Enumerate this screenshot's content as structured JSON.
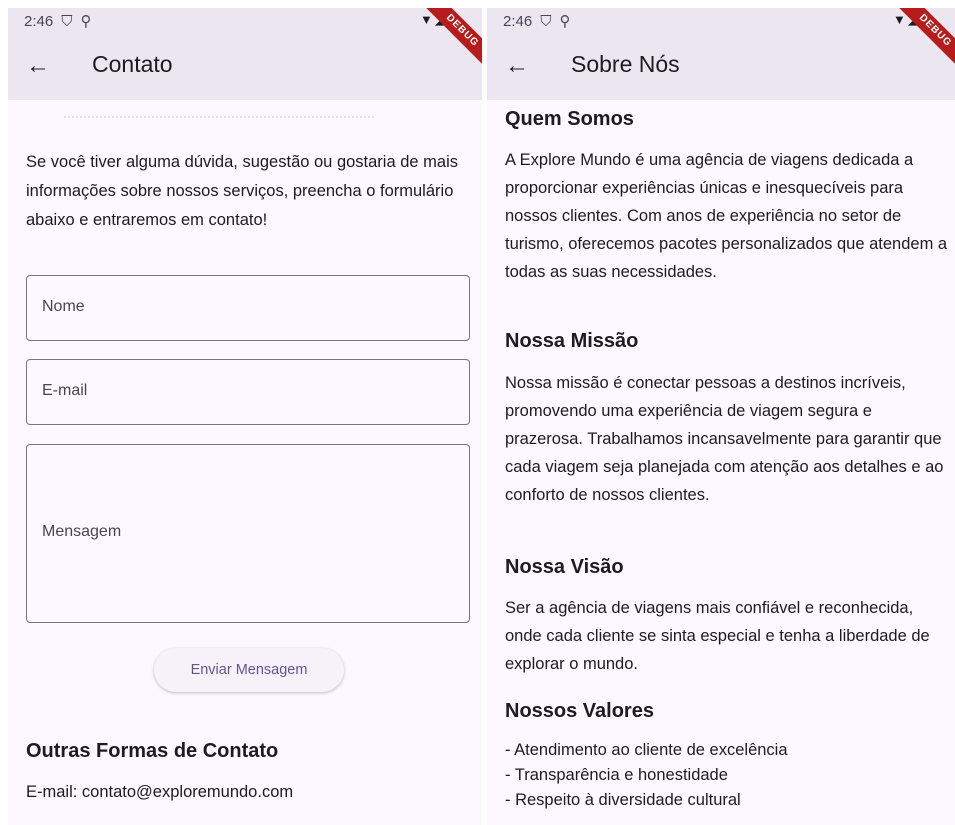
{
  "contact": {
    "status_time": "2:46",
    "title": "Contato",
    "intro": "Se você tiver alguma dúvida, sugestão ou gostaria de mais informações sobre nossos serviços, preencha o formulário abaixo e entraremos em contato!",
    "fields": {
      "name": "Nome",
      "email": "E-mail",
      "message": "Mensagem"
    },
    "send_label": "Enviar Mensagem",
    "other_heading": "Outras Formas de Contato",
    "email_line": "E-mail: contato@exploremundo.com"
  },
  "about": {
    "status_time": "2:46",
    "title": "Sobre Nós",
    "sections": [
      {
        "heading": "Quem Somos",
        "text": "A Explore Mundo é uma agência de viagens dedicada a proporcionar experiências únicas e inesquecíveis para nossos clientes. Com anos de experiência no setor de turismo, oferecemos pacotes personalizados que atendem a todas as suas necessidades."
      },
      {
        "heading": "Nossa Missão",
        "text": "Nossa missão é conectar pessoas a destinos incríveis, promovendo uma experiência de viagem segura e prazerosa. Trabalhamos incansavelmente para garantir que cada viagem seja planejada com atenção aos detalhes e ao conforto de nossos clientes."
      },
      {
        "heading": "Nossa Visão",
        "text": "Ser a agência de viagens mais confiável e reconhecida, onde cada cliente se sinta especial e tenha a liberdade de explorar o mundo."
      },
      {
        "heading": "Nossos Valores",
        "values": [
          "- Atendimento ao cliente de excelência",
          "- Transparência e honestidade",
          "- Respeito à diversidade cultural"
        ]
      }
    ]
  },
  "debug_label": "DEBUG",
  "icons": {
    "back": "back-arrow-icon",
    "status": [
      "shield-icon",
      "mic-icon",
      "wifi-icon",
      "signal-icon",
      "battery-icon"
    ]
  }
}
